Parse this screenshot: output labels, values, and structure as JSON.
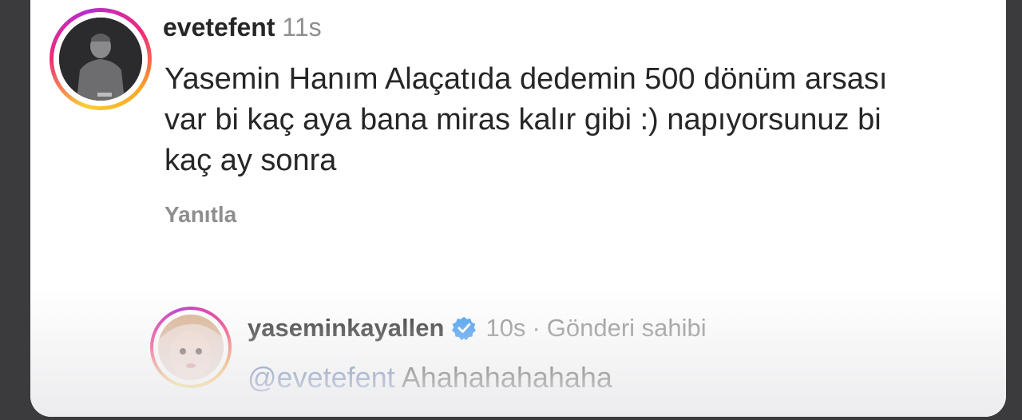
{
  "comment1": {
    "username": "evetefent",
    "time": "11s",
    "text": "Yasemin Hanım Alaçatıda dedemin 500 dönüm arsası var bi kaç aya bana miras kalır gibi :) napıyorsunuz bi kaç ay sonra",
    "reply_label": "Yanıtla"
  },
  "comment2": {
    "username": "yaseminkayallen",
    "time": "10s",
    "separator": "·",
    "owner_label": "Gönderi sahibi",
    "mention": "@evetefent",
    "text": "Ahahahahahaha"
  },
  "icons": {
    "verified": "verified-badge-icon"
  },
  "colors": {
    "verified": "#3897f0",
    "mention": "#3b5998",
    "muted": "#8e8e8e",
    "text": "#262626"
  }
}
